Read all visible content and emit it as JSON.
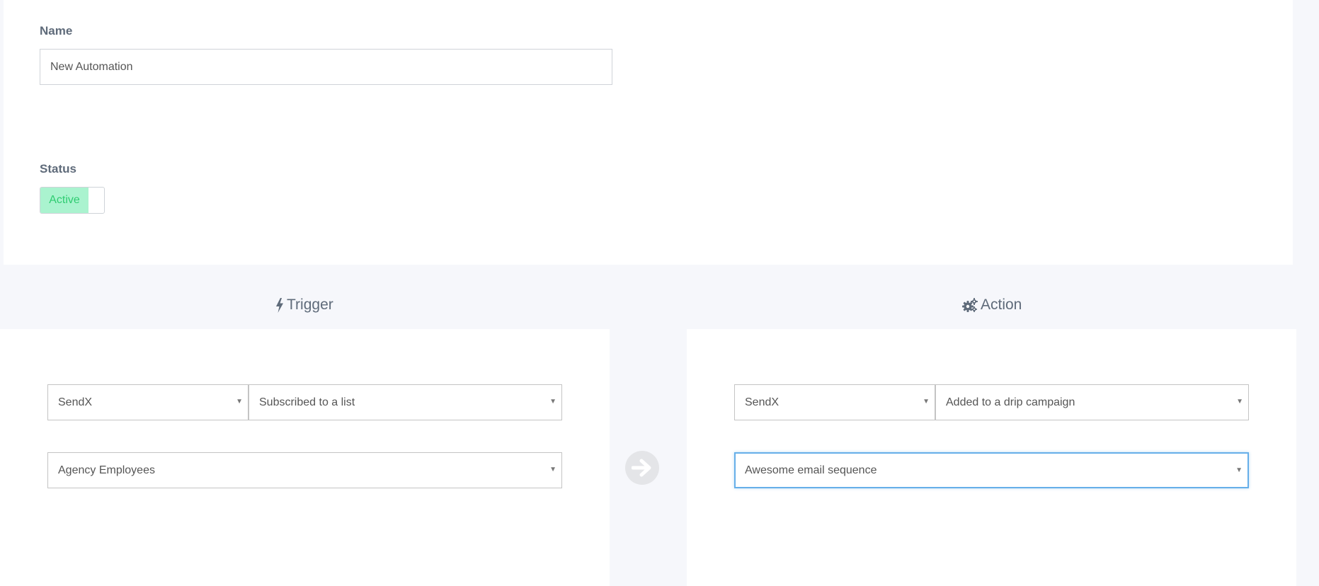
{
  "form": {
    "name_label": "Name",
    "name_value": "New Automation",
    "status_label": "Status",
    "status_toggle_label": "Active",
    "status_on": true
  },
  "trigger": {
    "title": "Trigger",
    "icon": "bolt-icon",
    "app_select": "SendX",
    "event_select": "Subscribed to a list",
    "list_select": "Agency Employees"
  },
  "action": {
    "title": "Action",
    "icon": "cogs-icon",
    "app_select": "SendX",
    "event_select": "Added to a drip campaign",
    "campaign_select": "Awesome email sequence"
  },
  "connector": {
    "icon": "arrow-right-circle-icon"
  },
  "colors": {
    "toggle_on_bg": "#aaf3cf",
    "toggle_on_text": "#2ecc71",
    "focus_border": "#66afe9",
    "page_bg": "#f6f7fb"
  }
}
